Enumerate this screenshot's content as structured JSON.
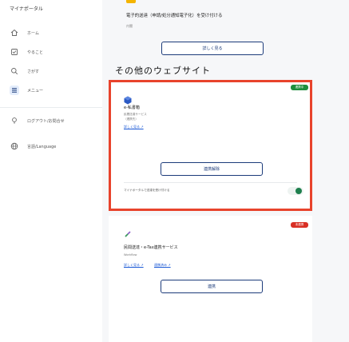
{
  "sidebar": {
    "app_title": "マイナポータル",
    "items": [
      {
        "label": "ホーム",
        "icon": "home-icon"
      },
      {
        "label": "やること",
        "icon": "checklist-icon"
      },
      {
        "label": "さがす",
        "icon": "search-icon"
      },
      {
        "label": "メニュー",
        "icon": "menu-icon"
      },
      {
        "label": "ログアウト/お問合せ",
        "icon": "logout-icon"
      },
      {
        "label": "言語/Language",
        "icon": "globe-icon"
      }
    ]
  },
  "top_card": {
    "title": "電子的送達（申請/処分通知電子化）を受け付ける",
    "sub": "内閣",
    "button": "詳しく見る"
  },
  "section": {
    "title": "その他のウェブサイト"
  },
  "cards": [
    {
      "badge": "連携中",
      "badge_color": "#1e8e3e",
      "name": "e-私書箱",
      "sub1": "民間送達サービス",
      "sub2": "（連携先）",
      "links": [
        "詳しく見る"
      ],
      "button": "連携解除",
      "toggle_label": "マイナポータルで送達を受け付ける"
    },
    {
      "badge": "未連携",
      "badge_color": "#d93025",
      "name": "民間送達・e-Tax連携サービス",
      "sub1": "Workflow",
      "links": [
        "詳しく見る",
        "連携済み"
      ],
      "button": "連携"
    }
  ]
}
